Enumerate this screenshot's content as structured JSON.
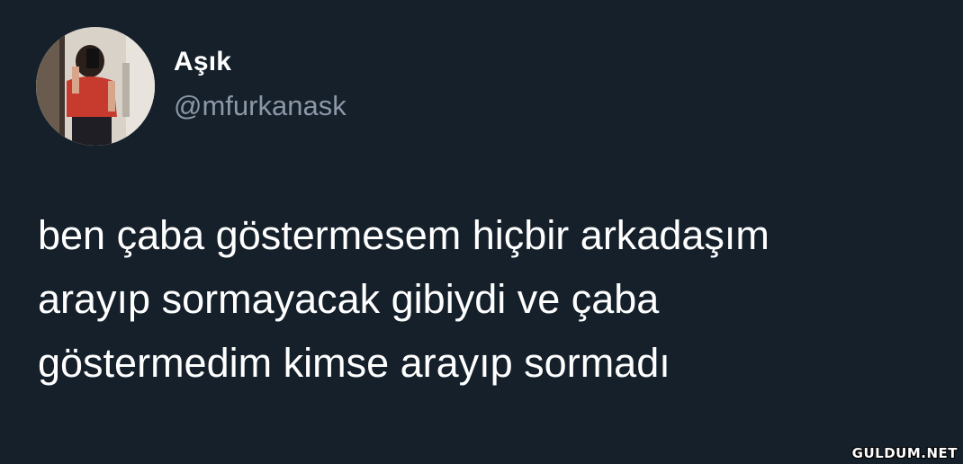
{
  "author": {
    "display_name": "Aşık",
    "handle": "@mfurkanask",
    "avatar_icon": "profile-photo-avatar"
  },
  "tweet": {
    "text": "ben çaba göstermesem hiçbir arkadaşım\narayıp sormayacak gibiydi ve çaba\ngöstermedim kimse arayıp sormadı"
  },
  "watermark": "GULDUM.NET",
  "colors": {
    "background": "#15202b",
    "text_primary": "#ffffff",
    "text_secondary": "#8b98a5"
  }
}
